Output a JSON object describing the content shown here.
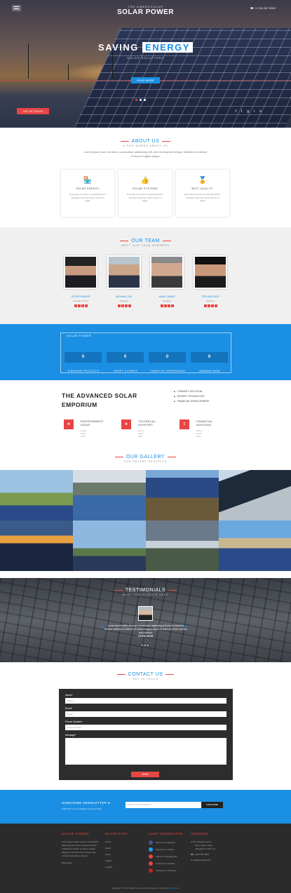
{
  "hero": {
    "brand_small": "THE AMBERSOLAR",
    "brand": "SOLAR POWER",
    "phone": "+1 234 567 8900",
    "title_plain": "SAVING",
    "title_highlight": "ENERGY",
    "subtitle": "SOLAR SOLUTIONS",
    "button": "READ MORE",
    "red_button": "GET IN TOUCH",
    "social_icons": [
      "facebook-icon",
      "twitter-icon",
      "google-plus-icon",
      "linkedin-icon"
    ]
  },
  "about": {
    "title": "ABOUT US",
    "subtitle": "A FEW WORDS ABOUT US",
    "text": "Lorem ipsum dolor sit amet, consectetur adipisicing elit, sed do eiusmod tempor incididunt ut labore et dolore magna aliqua.",
    "cards": [
      {
        "title": "SOLAR ENERGY",
        "icon": "store-icon",
        "text": "Duis aute irure dolor in reprehenderit in voluptate velit esse cillum dolore eu fugiat."
      },
      {
        "title": "SOLAR SYSTEMS",
        "icon": "thumbs-up-icon",
        "text": "Duis aute irure dolor in reprehenderit in voluptate velit esse cillum dolore eu fugiat."
      },
      {
        "title": "BEST QUALITY",
        "icon": "award-icon",
        "text": "Duis aute irure dolor in reprehenderit in voluptate velit esse cillum dolore eu fugiat."
      }
    ]
  },
  "team": {
    "title": "OUR TEAM",
    "subtitle": "MEET OUR TEAM MEMBERS",
    "members": [
      {
        "name": "PETER PARKER",
        "role": "Founder & CEO"
      },
      {
        "name": "MICHAEL LEE",
        "role": "Manager"
      },
      {
        "name": "MARK JAMES",
        "role": "Designer"
      },
      {
        "name": "STEVEN FORD",
        "role": "Engineer"
      }
    ]
  },
  "stats": {
    "label": "SOLAR POWER",
    "items": [
      {
        "value": "0",
        "label": "FINISHED PROJECTS"
      },
      {
        "value": "0",
        "label": "HAPPY CLIENTS"
      },
      {
        "value": "0",
        "label": "YEARS OF EXPERIENCE"
      },
      {
        "value": "0",
        "label": "AWARDS WON"
      }
    ]
  },
  "emporium": {
    "title_line1": "THE ADVANCED SOLAR",
    "title_line2": "EMPORIUM",
    "list": [
      "TURNKEY SOLUTION",
      "EXPERT TECHNOLOGY",
      "FINANCIAL DEVELOPMENT"
    ],
    "features": [
      {
        "line1": "ENVIRONMENT",
        "line2": "IDEAS",
        "sub": "Lorem ipsum dolor"
      },
      {
        "line1": "TECHNICAL",
        "line2": "SUPPORT",
        "sub": "Lorem ipsum dolor"
      },
      {
        "line1": "FINANCIAL",
        "line2": "ADVISING",
        "sub": "Lorem ipsum dolor"
      }
    ]
  },
  "gallery": {
    "title": "OUR GALLERY",
    "subtitle": "OUR RECENT PROJECTS"
  },
  "testimonials": {
    "title": "TESTIMONIALS",
    "subtitle": "WHAT OUR CLIENTS SAYS",
    "quote": "Lorem ipsum dolor sit amet consectetur adipiscing elit sed do eiusmod tempor incididunt ut labore et dolore magna aliqua ut enim ad minim veniam quis nostrud.",
    "name": "JOHN DOE"
  },
  "contact": {
    "title": "CONTACT US",
    "subtitle": "GET IN TOUCH",
    "name_label": "Name*",
    "name_placeholder": "Name",
    "email_label": "Email*",
    "email_placeholder": "Email",
    "phone_label": "Phone Number*",
    "phone_placeholder": "Phone Number",
    "message_label": "Message*",
    "submit": "SEND"
  },
  "newsletter": {
    "title": "SUBSCRIBE NEWSLETTER",
    "subtitle": "Subscribe to our newsletter for latest news",
    "placeholder": "Enter your email address",
    "button": "SUBSCRIBE"
  },
  "footer": {
    "col1": {
      "title": "SOLAR POWER",
      "lines": [
        "Lorem ipsum dolor sit amet consectetur",
        "adipiscing elit sed do eiusmod tempor",
        "incididunt ut labore et dolore magna",
        "aliqua ut enim ad minim veniam quis",
        "nostrud exercitation ullamco."
      ],
      "readmore": "Read More"
    },
    "col2": {
      "title": "NAVIGATION",
      "links": [
        "Home",
        "About",
        "Team",
        "Gallery",
        "Contact"
      ]
    },
    "col3": {
      "title": "KEEP CONNECTED",
      "links": [
        "Like us on Facebook",
        "Follow us on Twitter",
        "Add us on Google Plus",
        "Connect on Linkedin",
        "Follow us on Pinterest"
      ]
    },
    "col4": {
      "title": "ADDRESS",
      "lines": [
        "The company name",
        "Lorem ipsum dolor,",
        "Glasglow Dr 40 Fe 72.",
        "+1234 567 8901",
        "info@example.com"
      ]
    },
    "copyright_pre": "Copyright © 2017 Solar Power. All rights reserved | Design by",
    "copyright_link": "W3layouts"
  }
}
